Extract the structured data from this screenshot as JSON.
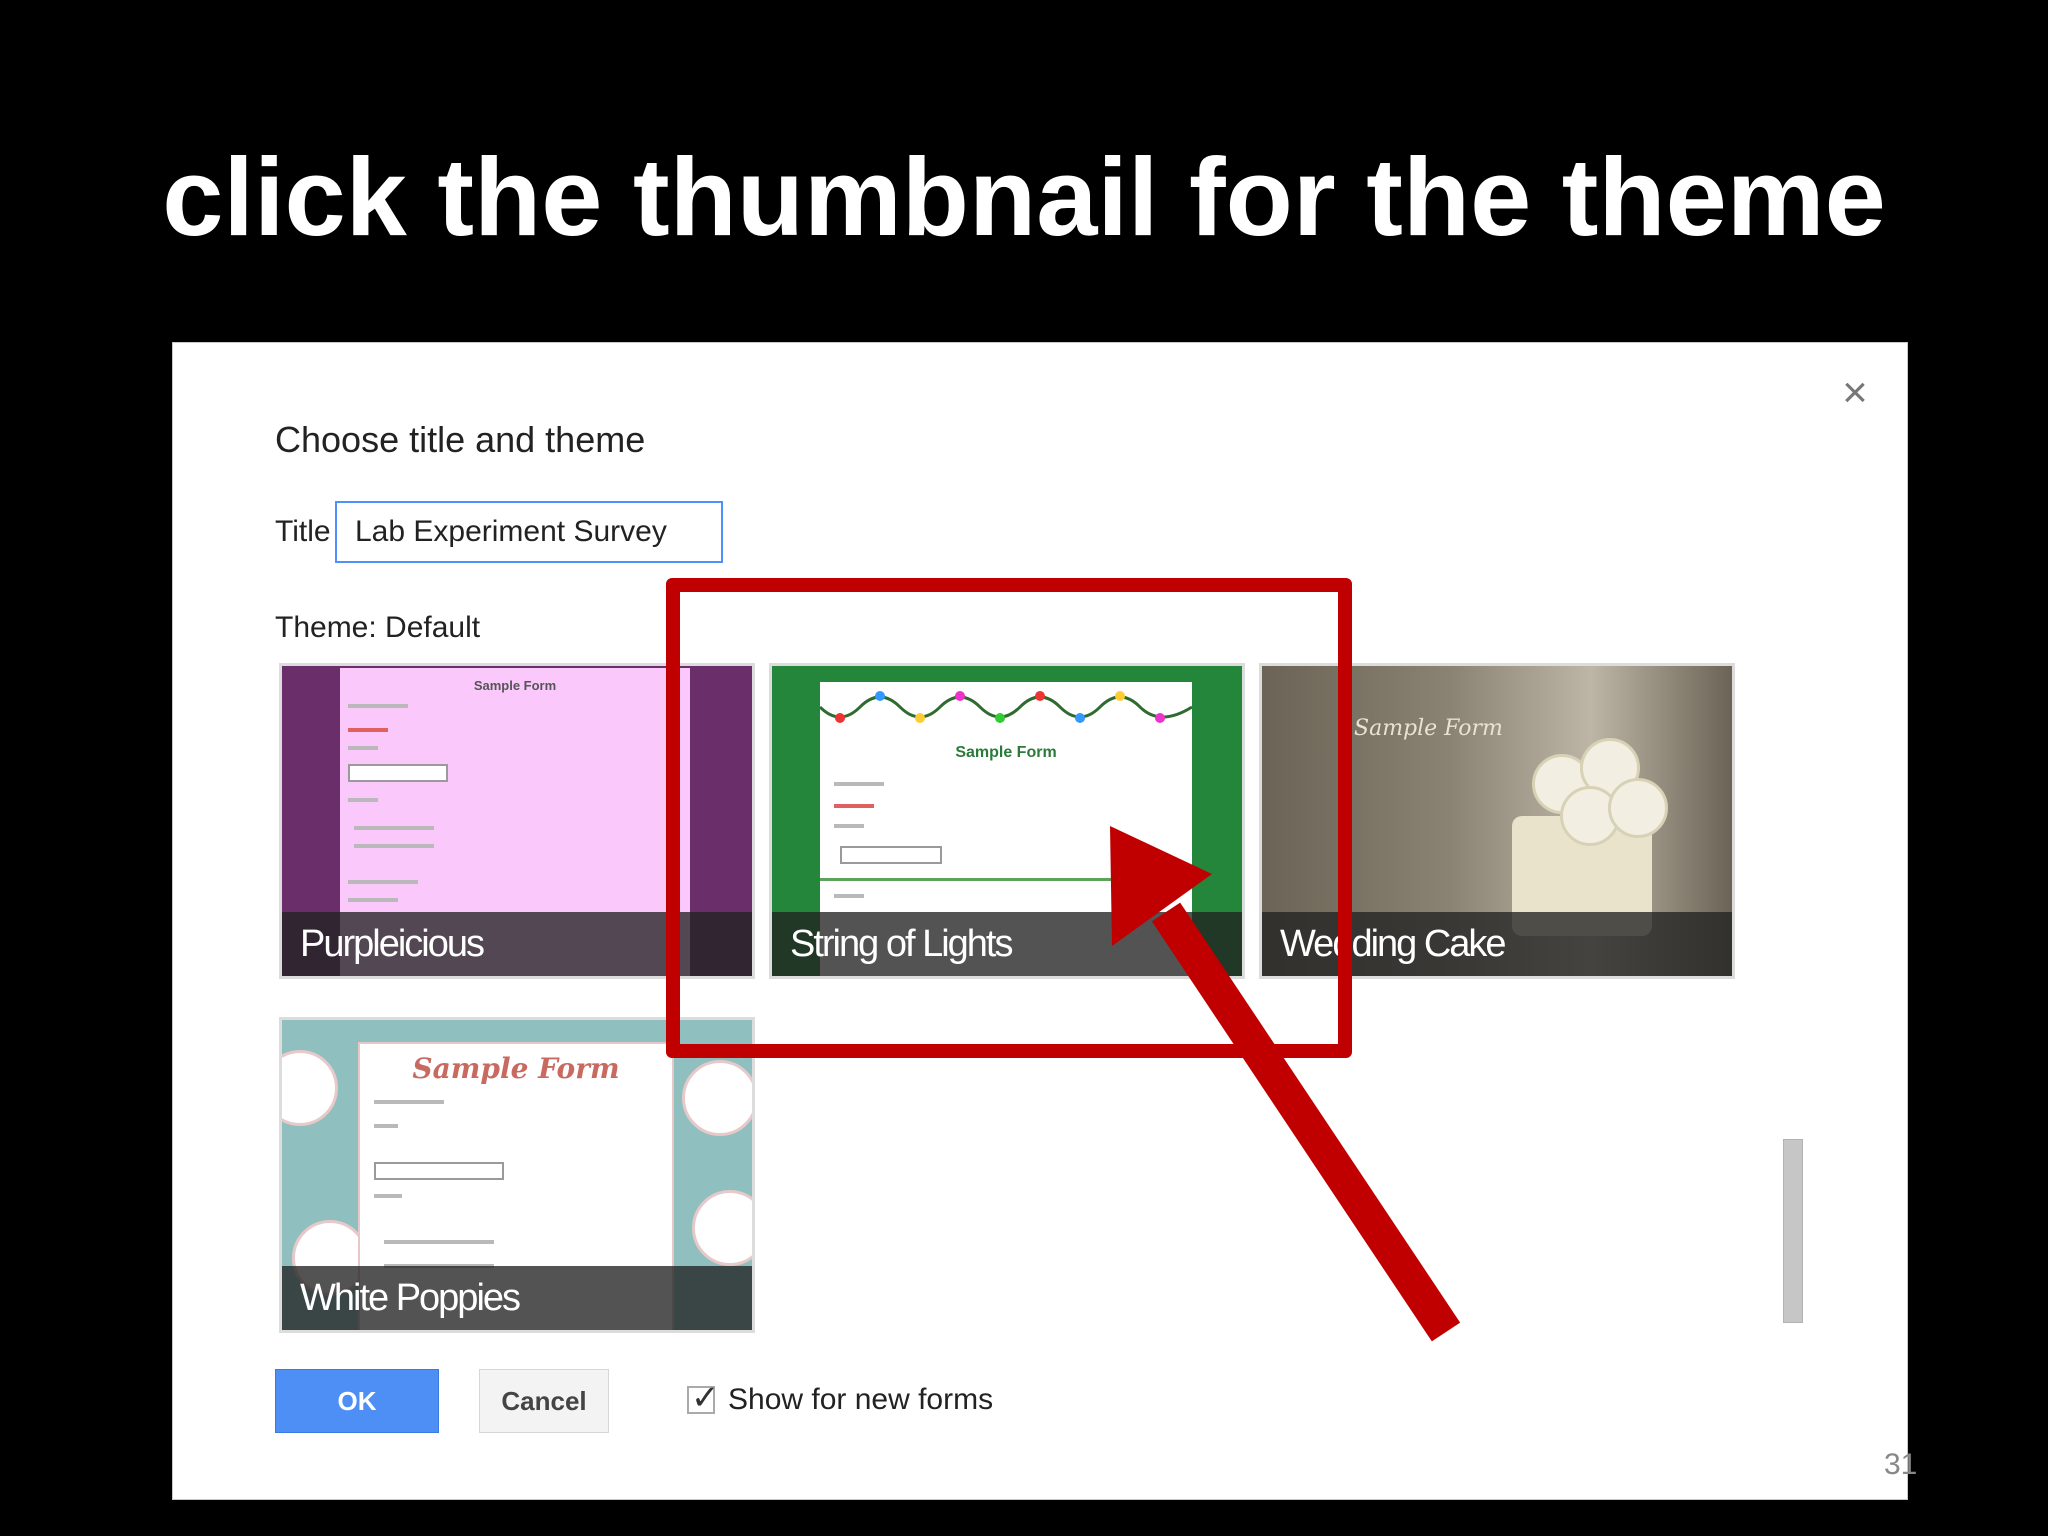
{
  "slide": {
    "title": "click the thumbnail for the theme",
    "page_number": "31"
  },
  "dialog": {
    "close_glyph": "×",
    "heading": "Choose title and theme",
    "title_label": "Title",
    "title_value": "Lab Experiment Survey",
    "theme_label": "Theme: Default",
    "themes": [
      {
        "name": "Purpleicious",
        "preview_heading": "Sample Form"
      },
      {
        "name": "String of Lights",
        "preview_heading": "Sample Form"
      },
      {
        "name": "Wedding Cake",
        "preview_heading": "Sample Form"
      },
      {
        "name": "White Poppies",
        "preview_heading": "Sample Form"
      }
    ],
    "ok_label": "OK",
    "cancel_label": "Cancel",
    "show_for_new_forms_label": "Show for new forms",
    "show_for_new_forms_checked": true,
    "checkmark_glyph": "✓"
  },
  "annotation": {
    "color": "#c00000"
  }
}
